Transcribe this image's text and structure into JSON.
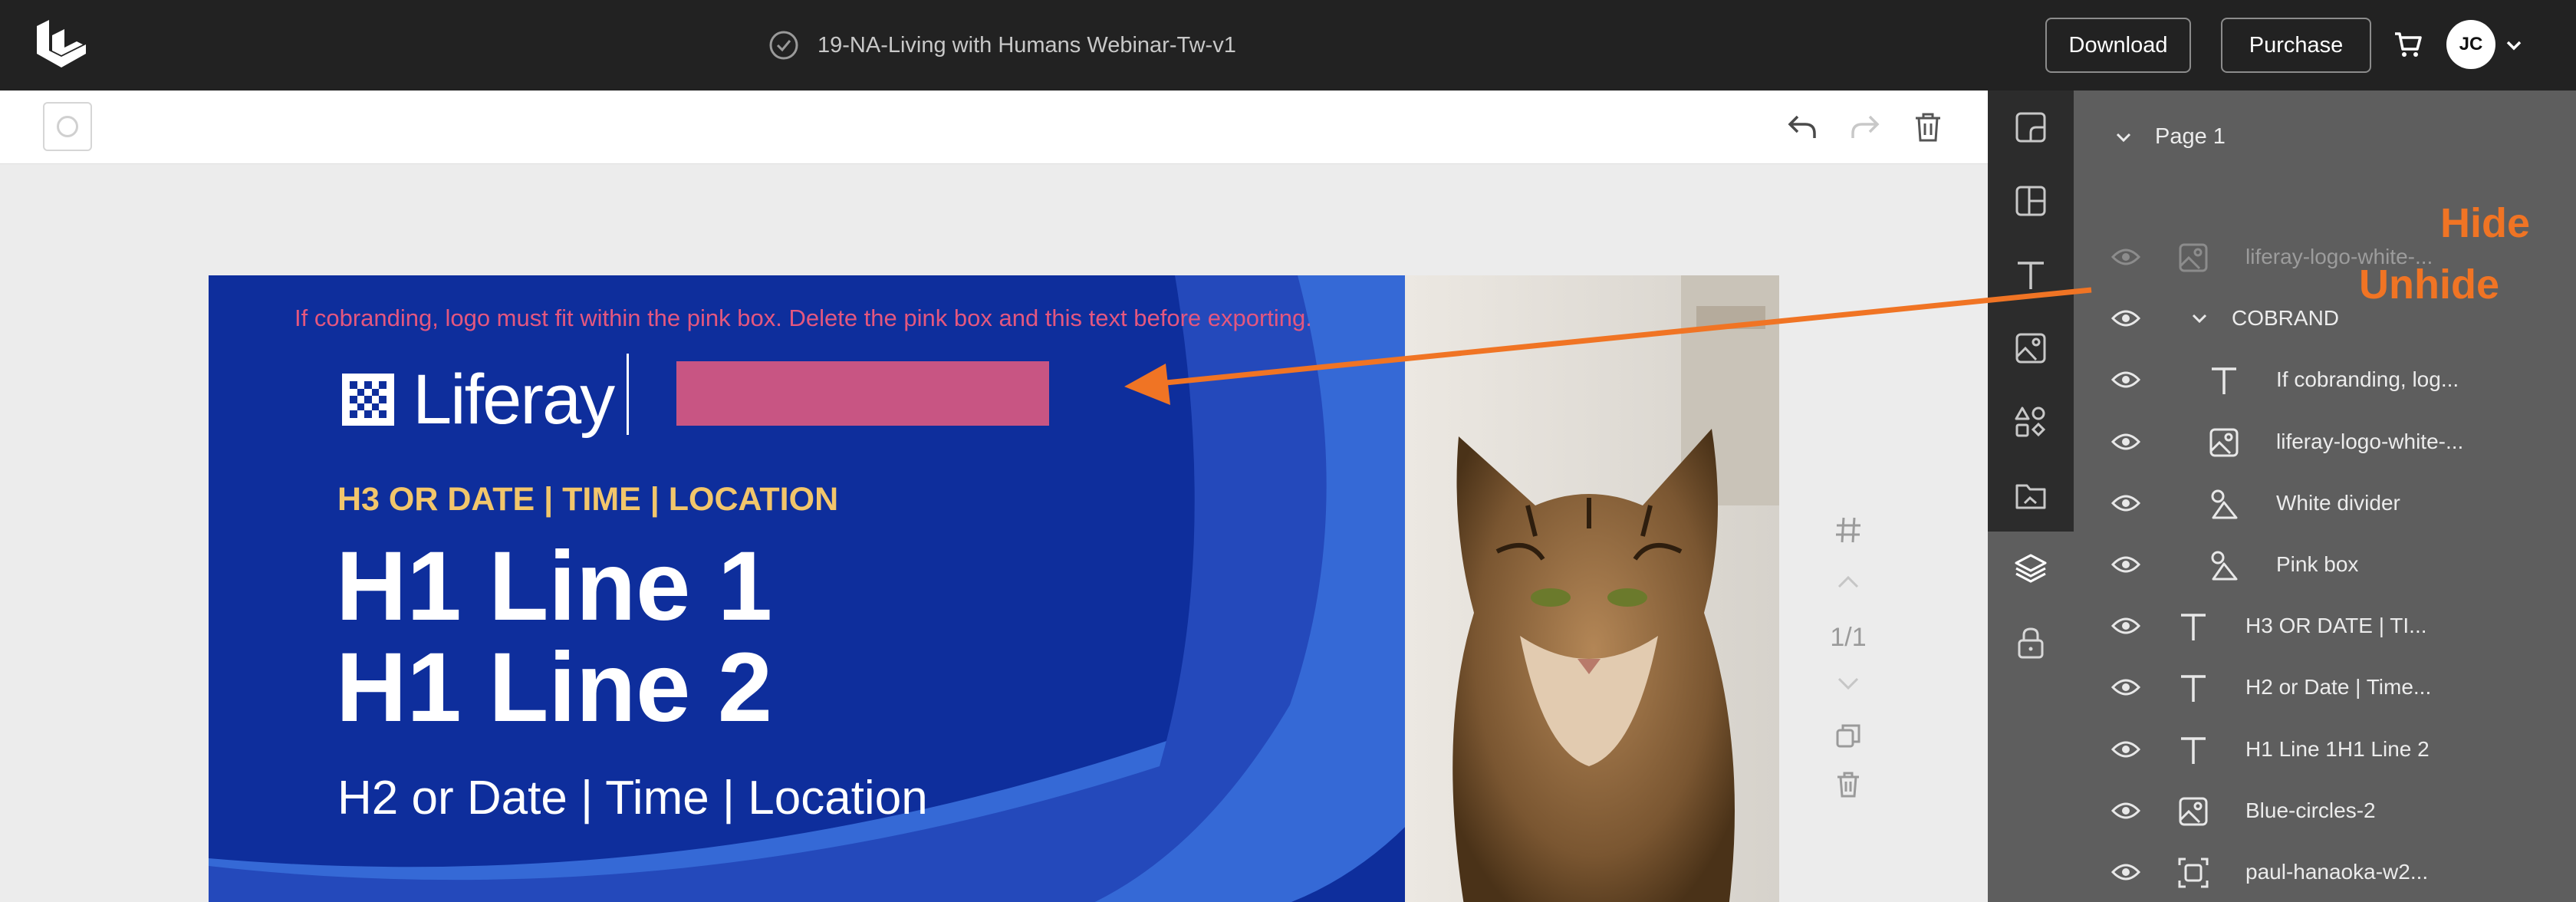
{
  "app": {
    "document_title": "19-NA-Living with Humans Webinar-Tw-v1",
    "download_label": "Download",
    "purchase_label": "Purchase",
    "user_initials": "JC"
  },
  "artboard": {
    "cobrand_note": "If cobranding, logo must fit within the pink box. Delete the pink box and this text before exporting.",
    "brand_name": "Liferay",
    "h3": "H3 OR DATE | TIME | LOCATION",
    "h1_line1": "H1 Line 1",
    "h1_line2": "H1 Line 2",
    "h2": "H2 or Date | Time | Location"
  },
  "canvas_controls": {
    "page_counter": "1/1"
  },
  "layers": {
    "page_label": "Page 1",
    "items": [
      {
        "name": "liferay-logo-white-...",
        "type": "image",
        "indent": 0,
        "dim": true
      },
      {
        "name": "COBRAND",
        "type": "group",
        "indent": 0,
        "dim": false
      },
      {
        "name": "If cobranding, log...",
        "type": "text",
        "indent": 1,
        "dim": false
      },
      {
        "name": "liferay-logo-white-...",
        "type": "image",
        "indent": 1,
        "dim": false
      },
      {
        "name": "White divider",
        "type": "shape",
        "indent": 1,
        "dim": false
      },
      {
        "name": "Pink box",
        "type": "shape",
        "indent": 1,
        "dim": false
      },
      {
        "name": "H3 OR DATE | TI...",
        "type": "text",
        "indent": 0,
        "dim": false
      },
      {
        "name": "H2 or Date | Time...",
        "type": "text",
        "indent": 0,
        "dim": false
      },
      {
        "name": "H1 Line 1H1 Line 2",
        "type": "text",
        "indent": 0,
        "dim": false
      },
      {
        "name": "Blue-circles-2",
        "type": "image",
        "indent": 0,
        "dim": false
      },
      {
        "name": "paul-hanaoka-w2...",
        "type": "photo",
        "indent": 0,
        "dim": false
      }
    ]
  },
  "annotations": {
    "hide_label": "Hide",
    "unhide_label": "Unhide",
    "color": "#f07424"
  },
  "colors": {
    "artboard_blue": "#0e2e9c",
    "pink_box": "#c85583",
    "h3_yellow": "#f2c66b",
    "topbar": "#222222",
    "panel": "#5e5e5e"
  },
  "icons": {
    "rail": [
      "templates-icon",
      "layout-icon",
      "text-icon",
      "image-icon",
      "shapes-icon",
      "uploads-icon",
      "layers-icon",
      "lock-icon"
    ],
    "toolbar": [
      "undo-icon",
      "redo-icon",
      "trash-icon"
    ]
  }
}
